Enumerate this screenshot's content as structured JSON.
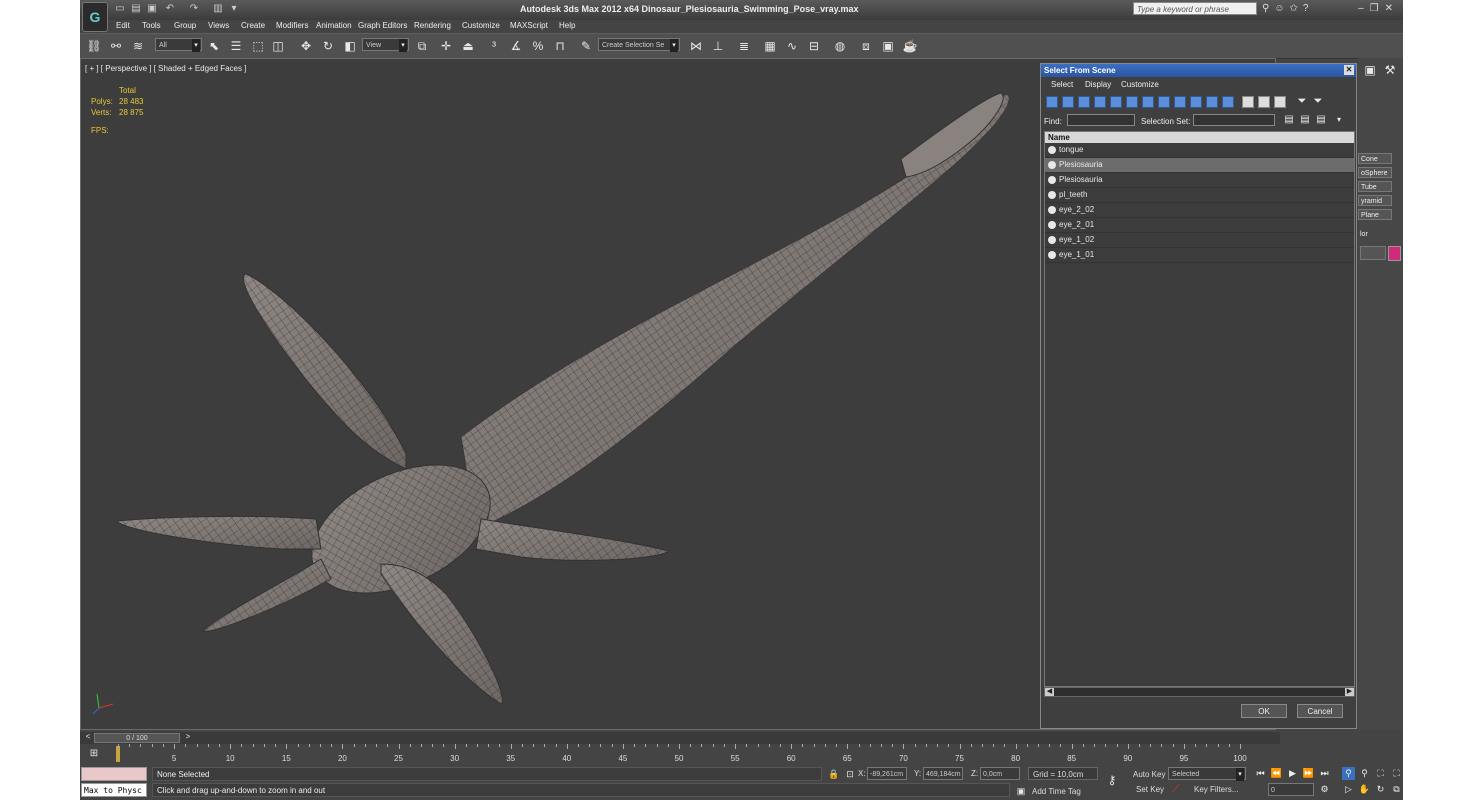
{
  "app": {
    "title": "Autodesk 3ds Max  2012 x64     Dinosaur_Plesiosauria_Swimming_Pose_vray.max",
    "search_placeholder": "Type a keyword or phrase",
    "logo_letter": "G"
  },
  "menu": [
    "Edit",
    "Tools",
    "Group",
    "Views",
    "Create",
    "Modifiers",
    "Animation",
    "Graph Editors",
    "Rendering",
    "Customize",
    "MAXScript",
    "Help"
  ],
  "toolbar": {
    "filter_value": "All",
    "refcoord_value": "View",
    "selection_set_value": "Create Selection Se"
  },
  "viewport": {
    "label": "[ + ] [ Perspective ] [ Shaded + Edged Faces ]",
    "stats_header": "Total",
    "polys_label": "Polys:",
    "polys_value": "28 483",
    "verts_label": "Verts:",
    "verts_value": "28 875",
    "fps_label": "FPS:",
    "axis_x": "x",
    "axis_y": "y",
    "axis_z": "z"
  },
  "dialog": {
    "title": "Select From Scene",
    "menu": [
      "Select",
      "Display",
      "Customize"
    ],
    "find_label": "Find:",
    "selection_set_label": "Selection Set:",
    "column_name": "Name",
    "items": [
      {
        "name": "tongue",
        "selected": false
      },
      {
        "name": "Plesiosauria",
        "selected": true
      },
      {
        "name": "Plesiosauria",
        "selected": false
      },
      {
        "name": "pl_teeth",
        "selected": false
      },
      {
        "name": "eye_2_02",
        "selected": false
      },
      {
        "name": "eye_2_01",
        "selected": false
      },
      {
        "name": "eye_1_02",
        "selected": false
      },
      {
        "name": "eye_1_01",
        "selected": false
      }
    ],
    "ok_label": "OK",
    "cancel_label": "Cancel"
  },
  "command_panel": {
    "items": [
      "Cone",
      "oSphere",
      "Tube",
      "yramid",
      "Plane"
    ],
    "color_label": "lor",
    "color_swatch": "#d02a7a"
  },
  "timeline": {
    "frame_label": "0 / 100",
    "ticks": [
      "0",
      "5",
      "10",
      "15",
      "20",
      "25",
      "30",
      "35",
      "40",
      "45",
      "50",
      "55",
      "60",
      "65",
      "70",
      "75",
      "80",
      "85",
      "90",
      "95",
      "100"
    ]
  },
  "status": {
    "maxscript_text": "Max to Physc",
    "selection_status": "None Selected",
    "prompt": "Click and drag up-and-down to zoom in and out",
    "x_label": "X:",
    "x_value": "-89,261cm",
    "y_label": "Y:",
    "y_value": "469,184cm",
    "z_label": "Z:",
    "z_value": "0,0cm",
    "grid": "Grid = 10,0cm",
    "add_time_tag": "Add Time Tag",
    "auto_key": "Auto Key",
    "auto_key_value": "Selected",
    "set_key": "Set Key",
    "key_filters": "Key Filters...",
    "frame_value": "0"
  }
}
